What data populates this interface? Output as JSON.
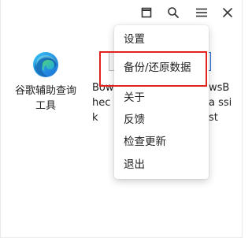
{
  "titlebar": {
    "buttons": [
      {
        "icon": "restore-window-icon"
      },
      {
        "icon": "search-icon"
      },
      {
        "icon": "hamburger-menu-icon"
      },
      {
        "icon": "close-icon"
      }
    ]
  },
  "apps": [
    {
      "label": "谷歌辅助查询工具",
      "icon": "edge-browser-icon"
    },
    {
      "label": "Bow heck"
    },
    {
      "label": "wsBa ssist"
    }
  ],
  "menu": {
    "items": [
      {
        "label": "设置"
      },
      {
        "label": "备份/还原数据"
      },
      {
        "label": "关于"
      },
      {
        "label": "反馈"
      },
      {
        "label": "检查更新"
      },
      {
        "label": "退出"
      }
    ]
  },
  "colors": {
    "highlight": "#e0241d",
    "text": "#222222"
  }
}
